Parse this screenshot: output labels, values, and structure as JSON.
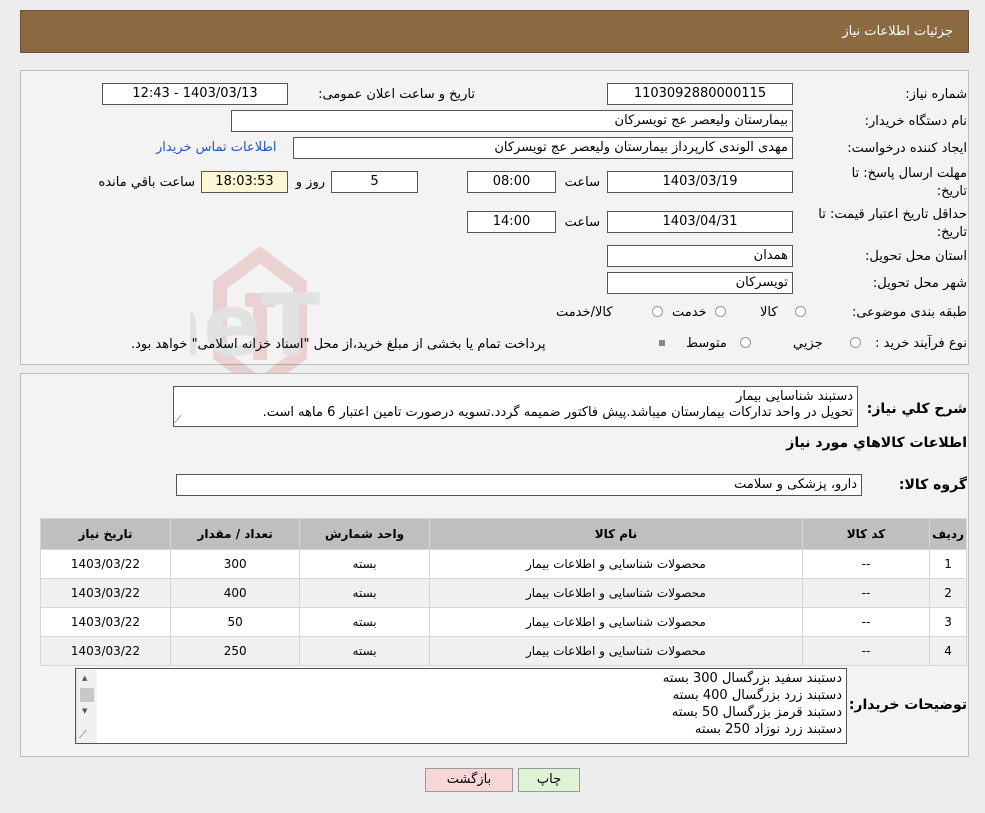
{
  "header": {
    "title": "جزئیات اطلاعات نیاز"
  },
  "fields": {
    "need_number_label": "شماره نیاز:",
    "need_number": "1103092880000115",
    "announce_label": "تاریخ و ساعت اعلان عمومی:",
    "announce_value": "1403/03/13 - 12:43",
    "buyer_org_label": "نام دستگاه خریدار:",
    "buyer_org": "بیمارستان ولیعصر  عج  تویسرکان",
    "creator_label": "ایجاد کننده درخواست:",
    "creator": "مهدی الوندی کارپرداز بیمارستان ولیعصر  عج  تویسرکان",
    "contact_link": "اطلاعات تماس خریدار",
    "deadline_label_1": "مهلت ارسال پاسخ: تا",
    "deadline_label_2": "تاریخ:",
    "deadline_date": "1403/03/19",
    "time_label": "ساعت",
    "deadline_time": "08:00",
    "days_value": "5",
    "days_label": "روز و",
    "remaining_time": "18:03:53",
    "remaining_label": "ساعت باقي مانده",
    "validity_label_1": "حداقل تاریخ اعتبار قیمت: تا",
    "validity_label_2": "تاریخ:",
    "validity_date": "1403/04/31",
    "validity_time": "14:00",
    "province_label": "استان محل تحویل:",
    "province": "همدان",
    "city_label": "شهر محل تحویل:",
    "city": "تویسرکان",
    "category_label": "طبقه بندی موضوعی:",
    "category_options": [
      "کالا",
      "خدمت",
      "کالا/خدمت"
    ],
    "process_label": "نوع فرآیند خرید :",
    "process_options": [
      "جزیي",
      "متوسط"
    ],
    "process_note": "پرداخت تمام یا بخشی از مبلغ خرید،از محل \"اسناد خزانه اسلامی\" خواهد بود."
  },
  "description": {
    "label": "شرح کلي نياز:",
    "line1": "دستبند شناسایی بیمار",
    "line2": "تحویل در واحد تدارکات بیمارستان میباشد.پیش فاکتور ضمیمه گردد.تسویه درصورت تامین اعتبار 6 ماهه است."
  },
  "goods": {
    "section_title": "اطلاعات کالاهاي مورد نياز",
    "group_label": "گروه کالا:",
    "group_value": "دارو، پزشکی و سلامت"
  },
  "table": {
    "headers": [
      "رديف",
      "کد کالا",
      "نام کالا",
      "واحد شمارش",
      "تعداد / مقدار",
      "تاريخ نياز"
    ],
    "rows": [
      [
        "1",
        "--",
        "محصولات شناسایی و اطلاعات بیمار",
        "بسته",
        "300",
        "1403/03/22"
      ],
      [
        "2",
        "--",
        "محصولات شناسایی و اطلاعات بیمار",
        "بسته",
        "400",
        "1403/03/22"
      ],
      [
        "3",
        "--",
        "محصولات شناسایی و اطلاعات بیمار",
        "بسته",
        "50",
        "1403/03/22"
      ],
      [
        "4",
        "--",
        "محصولات شناسایی و اطلاعات بیمار",
        "بسته",
        "250",
        "1403/03/22"
      ]
    ]
  },
  "buyer_notes": {
    "label": "توضیحات خریدار:",
    "lines": [
      "دستبند سفید بزرگسال 300 بسته",
      "دستبند زرد بزرگسال 400 بسته",
      "دستبند قرمز بزرگسال 50 بسته",
      "دستبند زرد نوزاد 250 بسته"
    ]
  },
  "buttons": {
    "print": "چاپ",
    "back": "بازگشت"
  },
  "watermark": {
    "text": "AriaTender.neT"
  },
  "colors": {
    "header_bg": "#8b6a42",
    "link": "#2457c5",
    "back_btn_bg": "#f6d6d6",
    "print_btn_bg": "#dff3d6"
  }
}
